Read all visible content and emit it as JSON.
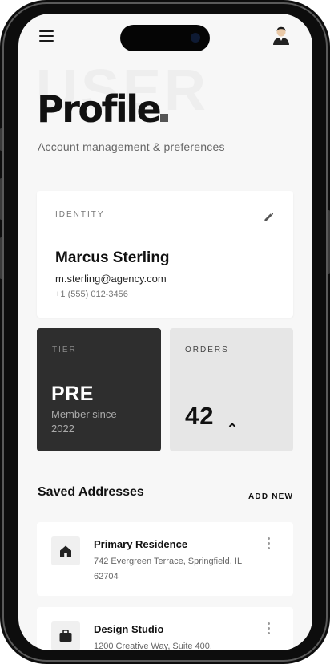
{
  "header": {
    "menu_icon": "hamburger-menu-icon",
    "avatar_icon": "user-avatar-icon"
  },
  "hero": {
    "watermark": "USER",
    "title": "Profile",
    "subtitle": "Account management & preferences"
  },
  "identity": {
    "eyebrow": "IDENTITY",
    "edit_icon": "pencil-icon",
    "name": "Marcus Sterling",
    "email": "m.sterling@agency.com",
    "phone": "+1 (555) 012-3456"
  },
  "tier": {
    "eyebrow": "TIER",
    "value": "PRE",
    "since": "Member since 2022"
  },
  "orders": {
    "eyebrow": "ORDERS",
    "value": "42",
    "trend_icon": "chevron-up-icon"
  },
  "addresses": {
    "title": "Saved Addresses",
    "add_label": "ADD NEW",
    "items": [
      {
        "icon": "home-icon",
        "name": "Primary Residence",
        "line": "742 Evergreen Terrace, Springfield, IL 62704"
      },
      {
        "icon": "briefcase-icon",
        "name": "Design Studio",
        "line": "1200 Creative Way, Suite 400,"
      }
    ]
  },
  "colors": {
    "screen_bg": "#f7f7f7",
    "tier_card": "#2e2e2e",
    "orders_card": "#e6e6e6",
    "text_primary": "#111111"
  }
}
